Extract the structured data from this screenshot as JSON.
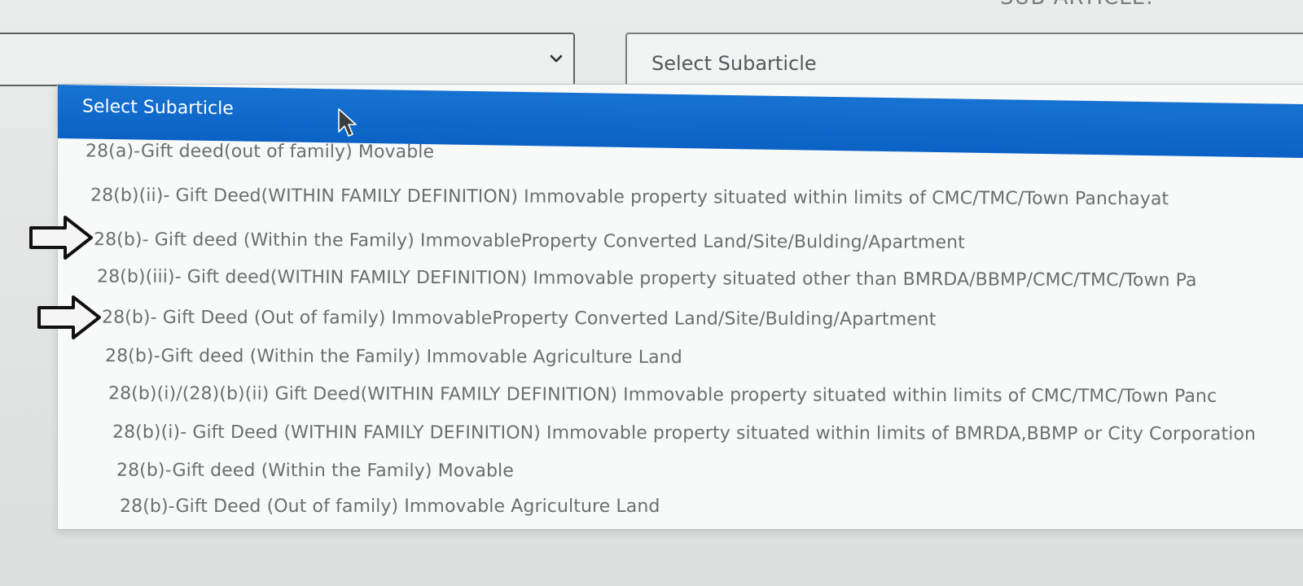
{
  "header": {
    "section_label": "SUB ARTICLE."
  },
  "left_select": {
    "icon": "chevron-down-icon"
  },
  "right_select": {
    "value": "Select Subarticle"
  },
  "dropdown": {
    "highlighted_label": "Select Subarticle",
    "options": [
      "28(a)-Gift deed(out of family) Movable",
      "28(b)(ii)- Gift Deed(WITHIN FAMILY DEFINITION) Immovable property situated within limits of CMC/TMC/Town Panchayat",
      "28(b)- Gift deed (Within the Family) ImmovableProperty Converted Land/Site/Bulding/Apartment",
      "28(b)(iii)- Gift deed(WITHIN FAMILY DEFINITION) Immovable property situated other than BMRDA/BBMP/CMC/TMC/Town Pa",
      "28(b)- Gift Deed (Out of family) ImmovableProperty Converted Land/Site/Bulding/Apartment",
      "28(b)-Gift deed (Within the Family) Immovable Agriculture Land",
      "28(b)(i)/(28)(b)(ii) Gift Deed(WITHIN FAMILY DEFINITION) Immovable property situated within limits of CMC/TMC/Town Panc",
      "28(b)(i)- Gift Deed (WITHIN FAMILY DEFINITION) Immovable property situated within limits of BMRDA,BBMP or City Corporation",
      "28(b)-Gift deed (Within the Family) Movable",
      "28(b)-Gift Deed (Out of family) Immovable Agriculture Land"
    ]
  },
  "annotations": {
    "arrow_icon": "outline-right-arrow-icon"
  },
  "colors": {
    "highlight": "#0b62c4",
    "option_text": "#6c6e70",
    "background": "#e3e6e4"
  }
}
